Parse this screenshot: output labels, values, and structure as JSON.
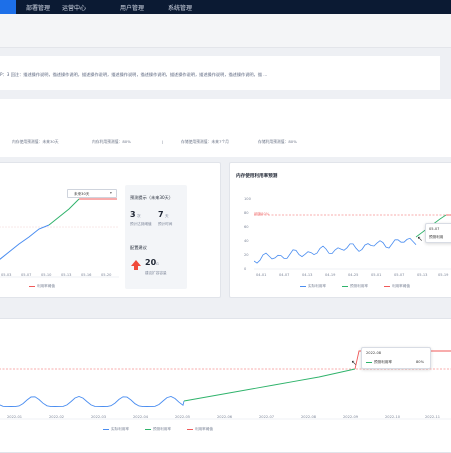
{
  "nav": {
    "items": [
      "部署管理",
      "运营中心",
      "用户管理",
      "系统管理"
    ],
    "active_color": "#1d6fe8"
  },
  "banner": {
    "text": "P：3    回注：描述操作说明，描述操作说明，描述操作说明，描述操作说明，描述操作说明，描述操作说明，描述操作说明，描述操作说明，描 ..."
  },
  "stats": {
    "items": [
      "内存使用预测值：未来30天",
      "内存利用预测值：80%",
      "|",
      "存储使用预测值：未来7个月",
      "存储利用预测值：80%"
    ]
  },
  "left_card": {
    "dropdown": "未来30天",
    "x_labels": [
      "05-03",
      "05-07",
      "05-10",
      "05-13",
      "05-16",
      "05-20"
    ],
    "legend": [
      "利用率阈值"
    ]
  },
  "forecast": {
    "title": "预测提示（未来30天）",
    "count1": "3",
    "count1_unit": "次",
    "count1_label": "预计达到阈值",
    "count2": "7",
    "count2_unit": "天",
    "count2_label": "预计时间",
    "advice_title": "配置建议",
    "advice_value": "20",
    "advice_unit": "G",
    "advice_label": "建议扩容容量"
  },
  "mem_chart": {
    "title": "内存使用利用率预测",
    "y_labels": [
      "100",
      "80",
      "60",
      "40",
      "20",
      "0"
    ],
    "threshold_label": "阈值80%",
    "x_labels": [
      "04-01",
      "04-07",
      "04-13",
      "04-19",
      "04-25",
      "05-01",
      "05-07",
      "05-13",
      "05-19"
    ],
    "legend": [
      "实际利用率",
      "预测利用率",
      "利用率阈值"
    ],
    "tooltip_date": "05-07",
    "tooltip_label": "预测利用"
  },
  "bottom_chart": {
    "x_labels": [
      "2022-01",
      "2022-02",
      "2022-03",
      "2022-04",
      "2022-05",
      "2022-06",
      "2022-07",
      "2022-08",
      "2022-09",
      "2022-10",
      "2022-11"
    ],
    "legend": [
      "实际利用率",
      "预测利用率",
      "利用率阈值"
    ],
    "tooltip_date": "2022-08",
    "tooltip_label": "预测利用率",
    "tooltip_value": "80%"
  },
  "colors": {
    "actual": "#4a8df0",
    "predicted": "#2fb36b",
    "threshold": "#f05a5a",
    "red_arrow": "#f04a3a"
  }
}
